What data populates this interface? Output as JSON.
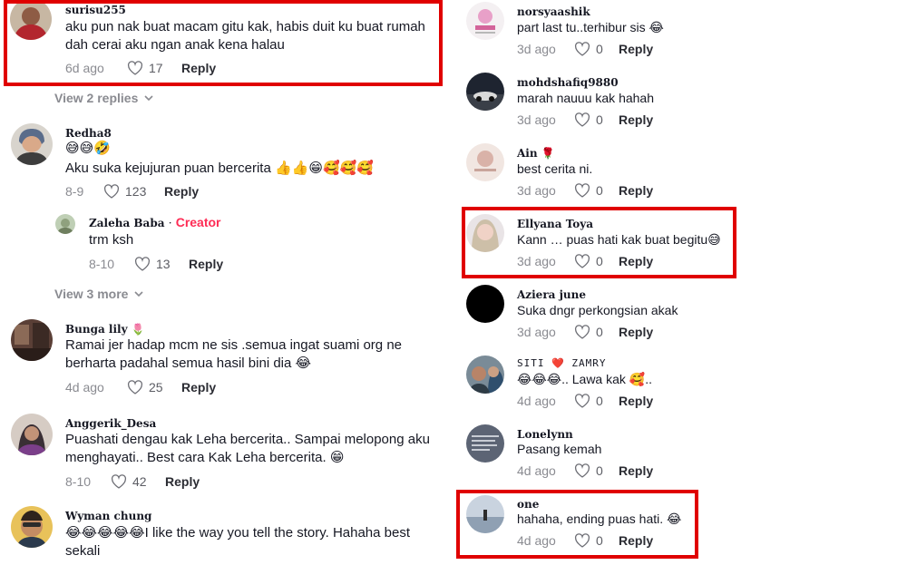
{
  "left_comments": [
    {
      "username": "surisu255",
      "text": "aku pun nak buat macam gitu kak, habis duit ku buat rumah dah cerai aku ngan anak kena halau",
      "date": "6d ago",
      "likes": "17",
      "reply": "Reply"
    },
    {
      "username": "Redha8",
      "text_emoji": "😅😅🤣",
      "text": "Aku suka kejujuran puan bercerita 👍👍😁🥰🥰🥰",
      "date": "8-9",
      "likes": "123",
      "reply": "Reply"
    },
    {
      "username": "Zaleha Baba",
      "separator": "·",
      "badge": "Creator",
      "text": "trm ksh",
      "date": "8-10",
      "likes": "13",
      "reply": "Reply"
    },
    {
      "username": "Bunga lily",
      "username_emoji": "🌷",
      "text": "Ramai jer hadap mcm ne sis .semua ingat suami org ne berharta padahal semua hasil bini dia 😂",
      "date": "4d ago",
      "likes": "25",
      "reply": "Reply"
    },
    {
      "username": "Anggerik_Desa",
      "text": "Puashati dengau kak Leha bercerita.. Sampai melopong aku menghayati.. Best cara Kak Leha bercerita. 😁",
      "date": "8-10",
      "likes": "42",
      "reply": "Reply"
    },
    {
      "username": "Wyman chung",
      "text": "😂😂😂😂😂I like the way you tell the story. Hahaha best sekali"
    }
  ],
  "view_replies": [
    "View 2 replies",
    "View 3 more"
  ],
  "right_comments": [
    {
      "username": "norsyaashik",
      "text": "part last tu..terhibur sis 😂",
      "date": "3d ago",
      "likes": "0",
      "reply": "Reply"
    },
    {
      "username": "mohdshafiq9880",
      "text": "marah nauuu kak hahah",
      "date": "3d ago",
      "likes": "0",
      "reply": "Reply"
    },
    {
      "username": "Ain",
      "username_emoji": "🌹",
      "text": "best cerita ni.",
      "date": "3d ago",
      "likes": "0",
      "reply": "Reply"
    },
    {
      "username": "Ellyana Toya",
      "text": "Kann … puas hati kak buat begitu😅",
      "date": "3d ago",
      "likes": "0",
      "reply": "Reply"
    },
    {
      "username": "Aziera june",
      "text": "Suka dngr perkongsian akak",
      "date": "3d ago",
      "likes": "0",
      "reply": "Reply"
    },
    {
      "username": "SITI ❤️ ZAMRY",
      "text": "😂😂😂.. Lawa kak 🥰..",
      "date": "4d ago",
      "likes": "0",
      "reply": "Reply"
    },
    {
      "username": "Lonelynn",
      "text": "Pasang kemah",
      "date": "4d ago",
      "likes": "0",
      "reply": "Reply"
    },
    {
      "username": "one",
      "text": "hahaha, ending puas hati. 😂",
      "date": "4d ago",
      "likes": "0",
      "reply": "Reply"
    }
  ],
  "colors": {
    "highlight": "#e00000",
    "creator": "#fe2c55",
    "muted": "#8a8b91"
  },
  "icons": {
    "like": "heart-outline-icon",
    "expand": "chevron-down-icon"
  }
}
